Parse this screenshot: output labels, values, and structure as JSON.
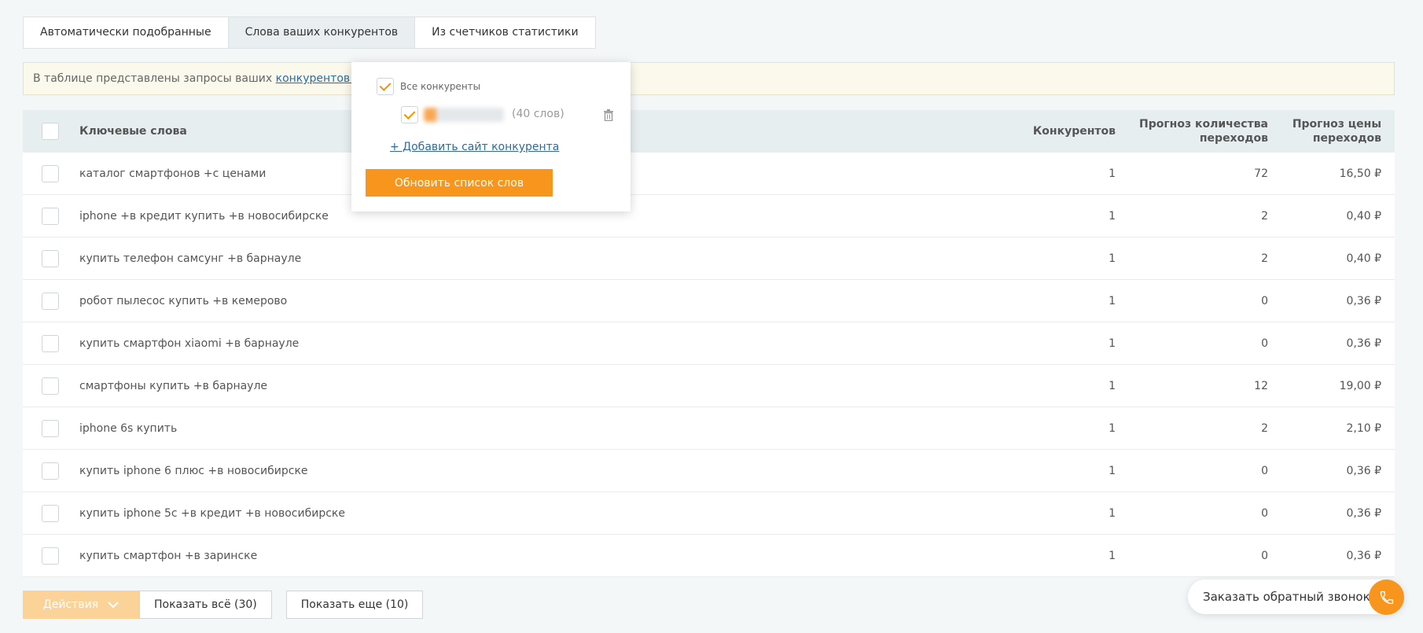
{
  "tabs": [
    {
      "label": "Автоматически подобранные",
      "active": false
    },
    {
      "label": "Слова ваших конкурентов",
      "active": true
    },
    {
      "label": "Из счетчиков статистики",
      "active": false
    }
  ],
  "info": {
    "text": "В таблице представлены запросы ваших ",
    "link": "конкурентов (1)"
  },
  "table": {
    "headers": {
      "keywords": "Ключевые слова",
      "competitors": "Конкурентов",
      "forecast_clicks": "Прогноз количества переходов",
      "forecast_price": "Прогноз цены переходов"
    },
    "rows": [
      {
        "keyword": "каталог смартфонов +с ценами",
        "competitors": "1",
        "clicks": "72",
        "price": "16,50 ₽"
      },
      {
        "keyword": "iphone +в кредит купить +в новосибирске",
        "competitors": "1",
        "clicks": "2",
        "price": "0,40 ₽"
      },
      {
        "keyword": "купить телефон самсунг +в барнауле",
        "competitors": "1",
        "clicks": "2",
        "price": "0,40 ₽"
      },
      {
        "keyword": "робот пылесос купить +в кемерово",
        "competitors": "1",
        "clicks": "0",
        "price": "0,36 ₽"
      },
      {
        "keyword": "купить смартфон xiaomi +в барнауле",
        "competitors": "1",
        "clicks": "0",
        "price": "0,36 ₽"
      },
      {
        "keyword": "смартфоны купить +в барнауле",
        "competitors": "1",
        "clicks": "12",
        "price": "19,00 ₽"
      },
      {
        "keyword": "iphone 6s купить",
        "competitors": "1",
        "clicks": "2",
        "price": "2,10 ₽"
      },
      {
        "keyword": "купить iphone 6 плюс +в новосибирске",
        "competitors": "1",
        "clicks": "0",
        "price": "0,36 ₽"
      },
      {
        "keyword": "купить iphone 5c +в кредит +в новосибирске",
        "competitors": "1",
        "clicks": "0",
        "price": "0,36 ₽"
      },
      {
        "keyword": "купить смартфон +в заринске",
        "competitors": "1",
        "clicks": "0",
        "price": "0,36 ₽"
      }
    ]
  },
  "popup": {
    "all_competitors": "Все конкуренты",
    "competitor_count": "(40 слов)",
    "add_link": "+ Добавить сайт конкурента",
    "update_button": "Обновить список слов"
  },
  "footer": {
    "actions": "Действия",
    "show_all": "Показать всё (30)",
    "show_more": "Показать еще (10)"
  },
  "callback": {
    "label": "Заказать обратный звонок"
  },
  "colors": {
    "accent": "#f7951d",
    "link": "#2a6ca0",
    "header_bg": "#e7eef0"
  },
  "icons": {
    "trash": "trash-icon",
    "phone": "phone-icon",
    "chevron": "chevron-down-icon",
    "check": "check-icon"
  }
}
